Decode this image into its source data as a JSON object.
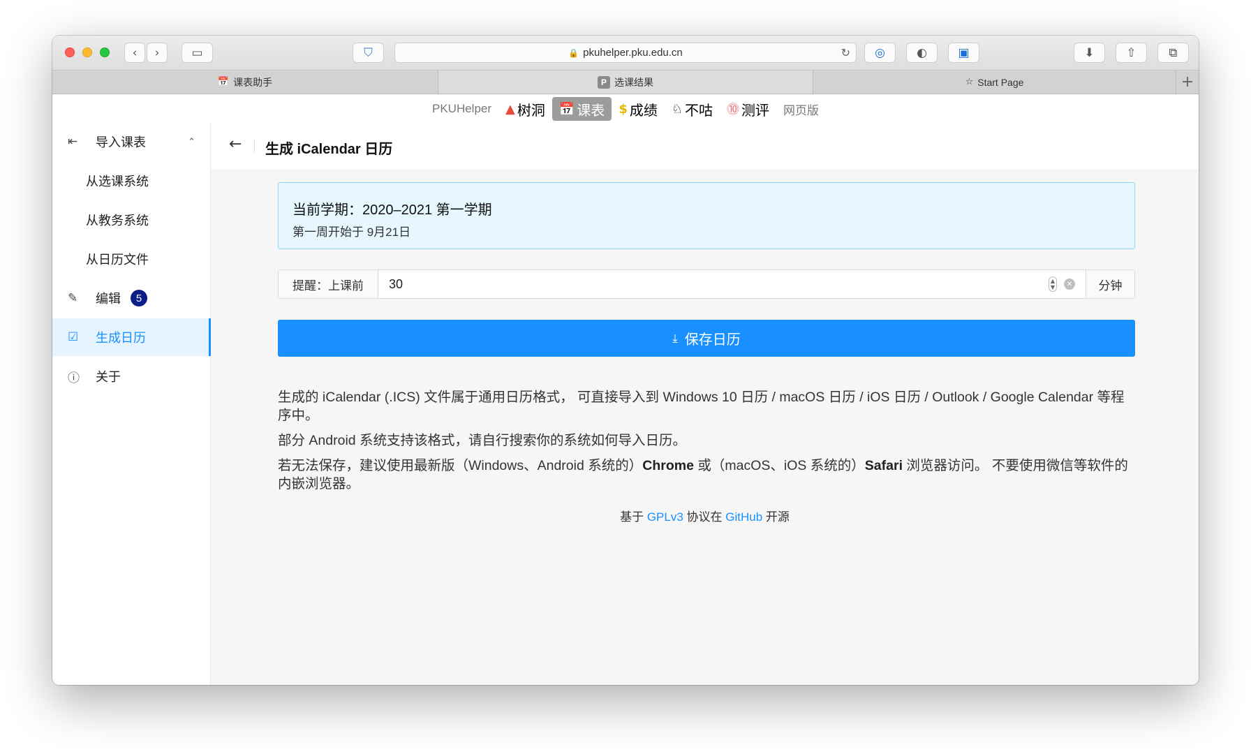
{
  "browser": {
    "url": "pkuhelper.pku.edu.cn",
    "tabs": [
      {
        "label": "课表助手",
        "icon": "calendar-icon"
      },
      {
        "label": "选课结果",
        "icon": "p-icon"
      },
      {
        "label": "Start Page",
        "icon": "star-icon"
      }
    ]
  },
  "topnav": {
    "brand": "PKUHelper",
    "items": [
      "树洞",
      "课表",
      "成绩",
      "不咕",
      "测评"
    ],
    "web": "网页版"
  },
  "sidebar": {
    "import_label": "导入课表",
    "from_course_system": "从选课系统",
    "from_academic_system": "从教务系统",
    "from_calendar_file": "从日历文件",
    "edit_label": "编辑",
    "edit_badge": "5",
    "generate_label": "生成日历",
    "about_label": "关于"
  },
  "header": {
    "title": "生成 iCalendar 日历"
  },
  "semester": {
    "title": "当前学期：2020–2021 第一学期",
    "first_week": "第一周开始于 9月21日"
  },
  "reminder": {
    "prefix": "提醒：上课前",
    "value": "30",
    "suffix": "分钟"
  },
  "save_button": "保存日历",
  "description": {
    "p1": "生成的 iCalendar (.ICS) 文件属于通用日历格式， 可直接导入到 Windows 10 日历 / macOS 日历 / iOS 日历 / Outlook / Google Calendar 等程序中。",
    "p2": "部分 Android 系统支持该格式，请自行搜索你的系统如何导入日历。",
    "p3_a": "若无法保存，建议使用最新版（Windows、Android 系统的）",
    "p3_chrome": "Chrome",
    "p3_b": " 或（macOS、iOS 系统的）",
    "p3_safari": "Safari",
    "p3_c": " 浏览器访问。 不要使用微信等软件的内嵌浏览器。"
  },
  "footer": {
    "a": "基于 ",
    "license": "GPLv3",
    "b": " 协议在 ",
    "github": "GitHub",
    "c": " 开源"
  },
  "colors": {
    "accent": "#1890ff",
    "info_bg": "#e6f7ff",
    "badge": "#0b1f8a"
  }
}
